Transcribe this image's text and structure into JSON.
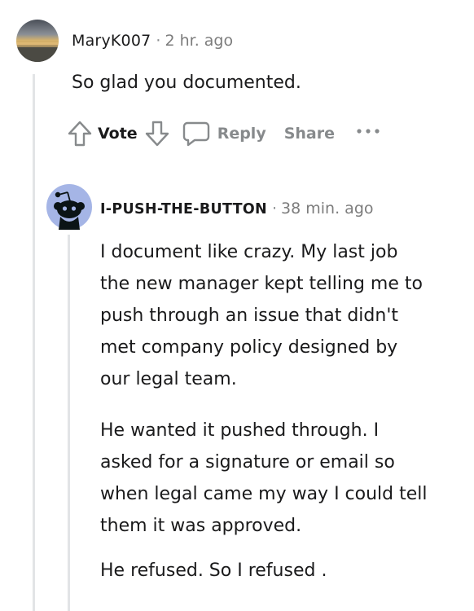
{
  "comment": {
    "author": "MaryK007",
    "separator": "·",
    "time": "2 hr. ago",
    "body": "So glad you documented.",
    "avatar_icon": "landscape-avatar-icon"
  },
  "actions": {
    "vote_label": "Vote",
    "reply_label": "Reply",
    "share_label": "Share",
    "upvote_icon": "upvote-arrow-icon",
    "downvote_icon": "downvote-arrow-icon",
    "reply_icon": "speech-bubble-icon",
    "more_icon": "ellipsis-icon"
  },
  "reply": {
    "author": "I-PUSH-THE-BUTTON",
    "separator": "·",
    "time": "38 min. ago",
    "avatar_icon": "reddit-snoo-avatar-icon",
    "paragraphs": [
      [
        "I document like crazy. My last job",
        "the new manager kept telling me to",
        "push through an issue that didn't",
        "met company policy designed by",
        "our legal team."
      ],
      [
        "He wanted it pushed through. I",
        "asked for a signature or email so",
        "when legal came my way I could tell",
        "them it was approved."
      ],
      [
        "He refused. So I refused ."
      ]
    ]
  },
  "colors": {
    "text": "#1a1a1b",
    "muted": "#878a8c",
    "thread_line": "#e2e4e6",
    "snoo_bg": "#a5b5e6"
  }
}
